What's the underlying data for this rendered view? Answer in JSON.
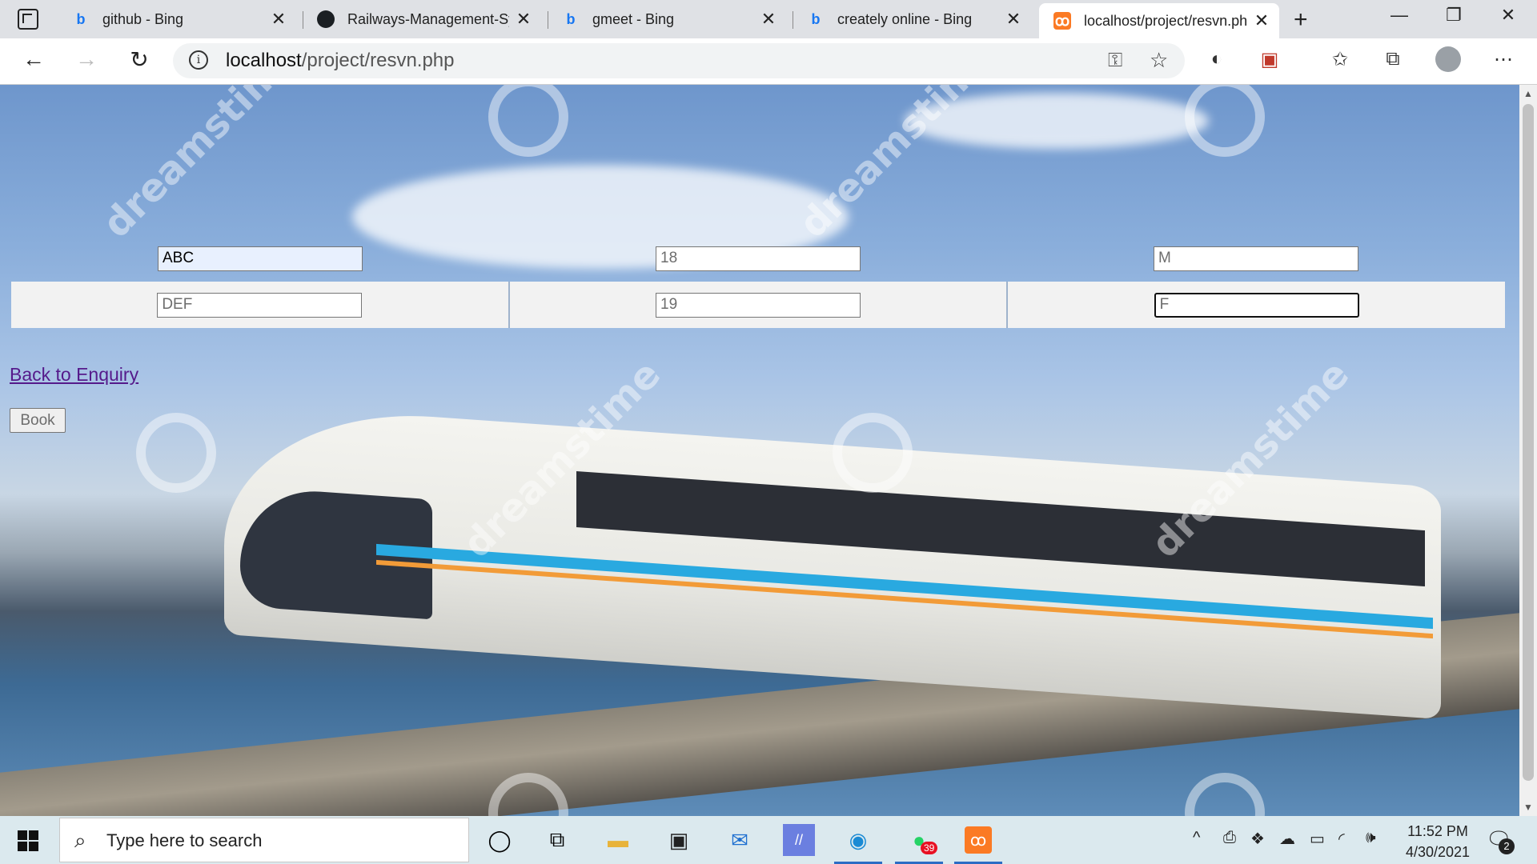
{
  "browser": {
    "tabs": [
      {
        "title": "github - Bing",
        "favicon": "bing-icon"
      },
      {
        "title": "Railways-Management-Sy",
        "favicon": "github-icon"
      },
      {
        "title": "gmeet - Bing",
        "favicon": "bing-icon"
      },
      {
        "title": "creately online - Bing",
        "favicon": "bing-icon"
      },
      {
        "title": "localhost/project/resvn.ph",
        "favicon": "xampp-icon",
        "active": true
      }
    ],
    "url_host": "localhost",
    "url_path": "/project/resvn.php"
  },
  "passengers": [
    {
      "name": "ABC",
      "age": "18",
      "gender": "M"
    },
    {
      "name": "DEF",
      "age": "19",
      "gender": "F"
    }
  ],
  "page": {
    "back_link": "Back to Enquiry",
    "book_button": "Book",
    "background_watermark": "dreamstime"
  },
  "taskbar": {
    "search_placeholder": "Type here to search",
    "time": "11:52 PM",
    "date": "4/30/2021",
    "whatsapp_badge": "39",
    "notification_count": "2"
  },
  "colors": {
    "visited_link": "#551a8b",
    "autofill_bg": "#e8f0fe",
    "xampp_orange": "#fb7a24"
  }
}
